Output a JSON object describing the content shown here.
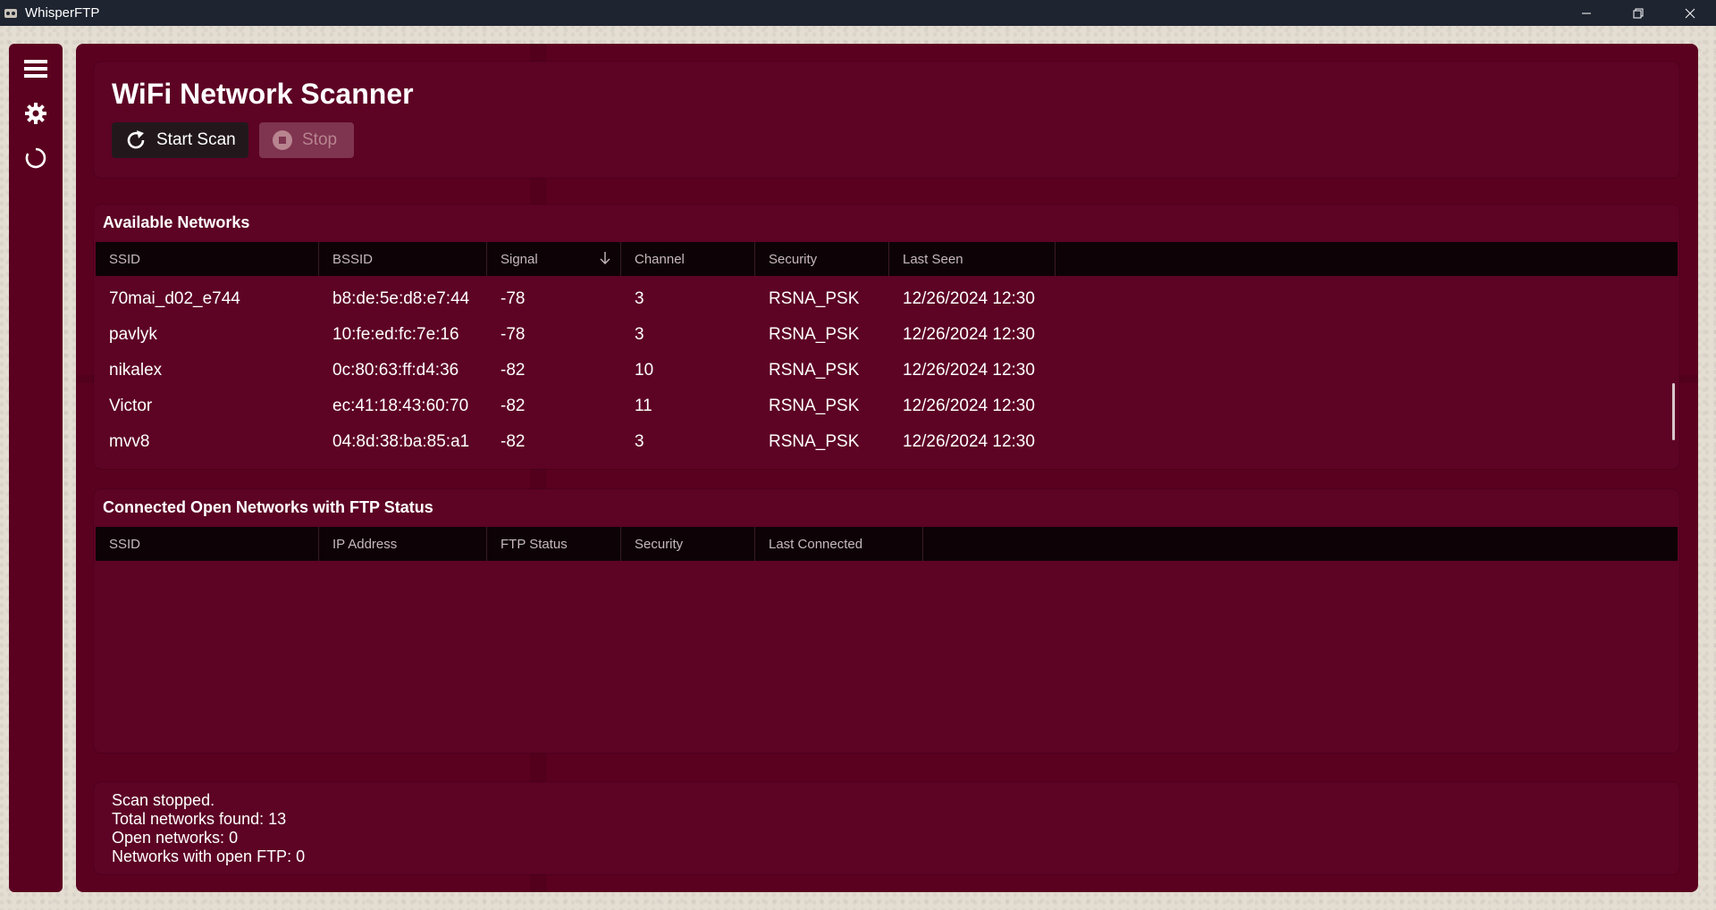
{
  "window": {
    "title": "WhisperFTP",
    "controls": [
      "minimize-icon",
      "restore-icon",
      "close-icon"
    ]
  },
  "sidebar": {
    "items": [
      {
        "icon": "hamburger-menu-icon"
      },
      {
        "icon": "gear-icon"
      },
      {
        "icon": "refresh-circle-icon"
      }
    ]
  },
  "header": {
    "title": "WiFi Network Scanner",
    "start_label": "Start Scan",
    "stop_label": "Stop"
  },
  "networks": {
    "title": "Available Networks",
    "columns": [
      "SSID",
      "BSSID",
      "Signal",
      "Channel",
      "Security",
      "Last Seen"
    ],
    "sort_column": "Signal",
    "rows": [
      [
        "70mai_d02_e744",
        "b8:de:5e:d8:e7:44",
        "-78",
        "3",
        "RSNA_PSK",
        "12/26/2024 12:30"
      ],
      [
        "pavlyk",
        "10:fe:ed:fc:7e:16",
        "-78",
        "3",
        "RSNA_PSK",
        "12/26/2024 12:30"
      ],
      [
        "nikalex",
        "0c:80:63:ff:d4:36",
        "-82",
        "10",
        "RSNA_PSK",
        "12/26/2024 12:30"
      ],
      [
        "Victor",
        "ec:41:18:43:60:70",
        "-82",
        "11",
        "RSNA_PSK",
        "12/26/2024 12:30"
      ],
      [
        "mvv8",
        "04:8d:38:ba:85:a1",
        "-82",
        "3",
        "RSNA_PSK",
        "12/26/2024 12:30"
      ]
    ]
  },
  "ftp": {
    "title": "Connected Open Networks with FTP Status",
    "columns": [
      "SSID",
      "IP Address",
      "FTP Status",
      "Security",
      "Last Connected"
    ],
    "rows": []
  },
  "status": {
    "lines": [
      "Scan stopped.",
      "Total networks found: 13",
      "Open networks: 0",
      "Networks with open FTP: 0"
    ]
  },
  "colors": {
    "panel": "#5d0324",
    "header_row": "#0d0306",
    "titlebar": "#1e2430"
  }
}
